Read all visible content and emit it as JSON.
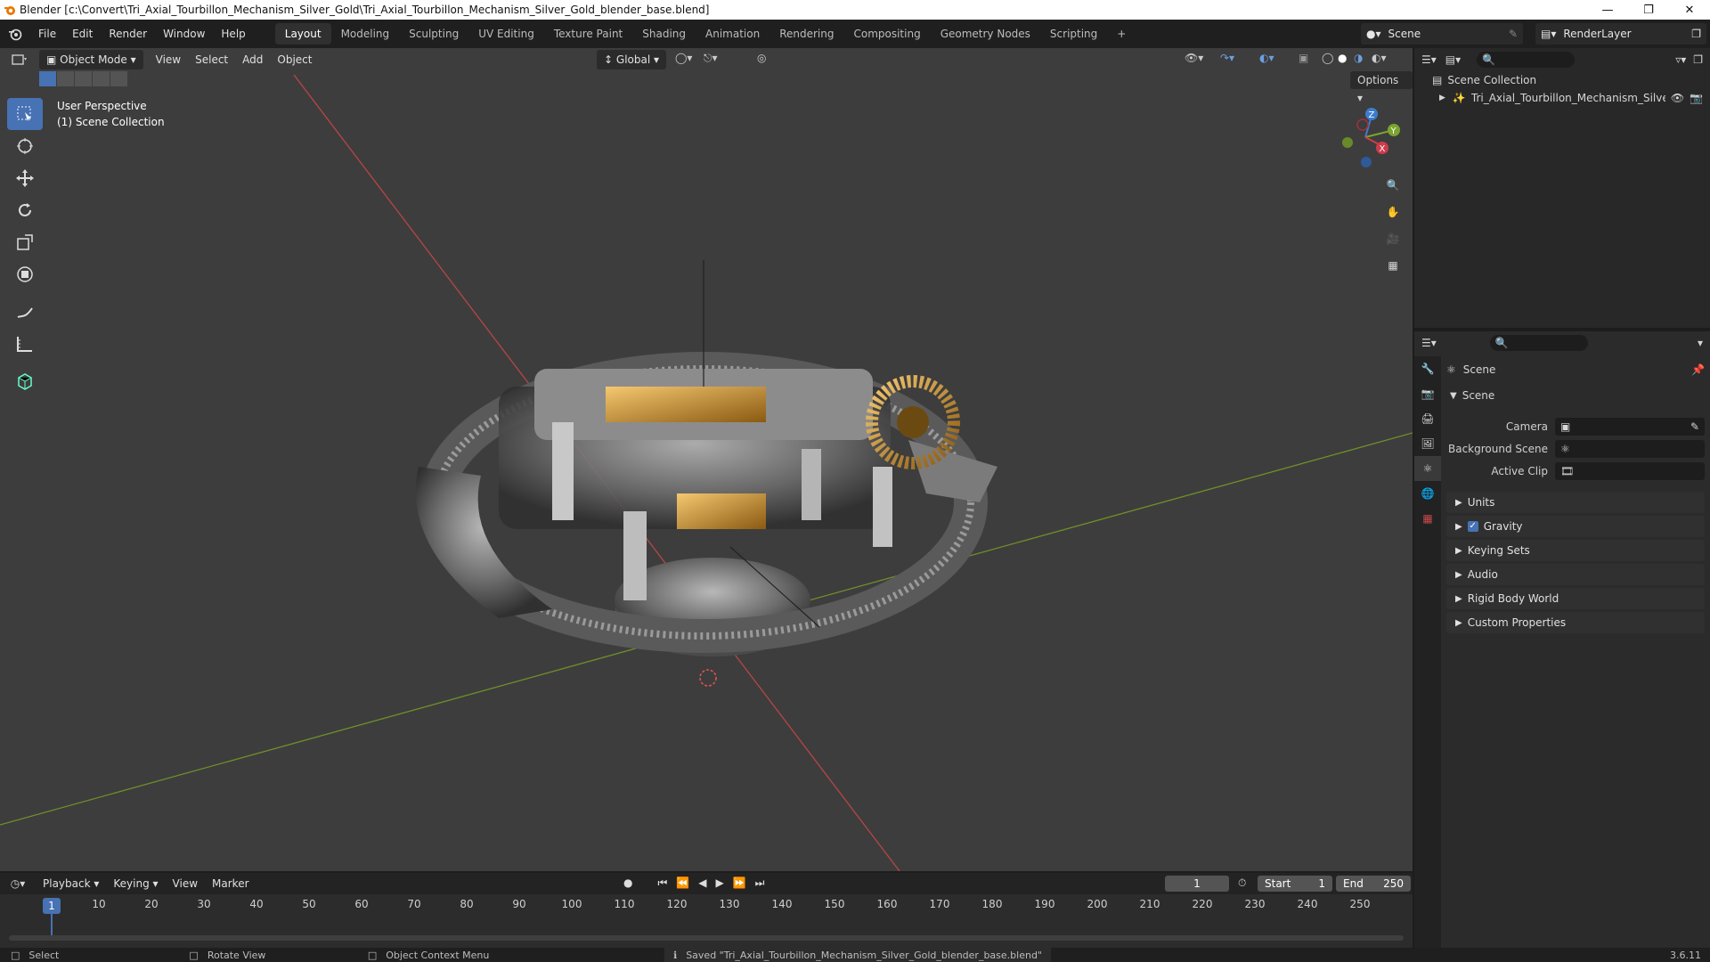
{
  "window": {
    "title": "Blender [c:\\Convert\\Tri_Axial_Tourbillon_Mechanism_Silver_Gold\\Tri_Axial_Tourbillon_Mechanism_Silver_Gold_blender_base.blend]"
  },
  "menu": {
    "items": [
      "File",
      "Edit",
      "Render",
      "Window",
      "Help"
    ]
  },
  "workspaces": {
    "tabs": [
      "Layout",
      "Modeling",
      "Sculpting",
      "UV Editing",
      "Texture Paint",
      "Shading",
      "Animation",
      "Rendering",
      "Compositing",
      "Geometry Nodes",
      "Scripting"
    ],
    "active": "Layout",
    "add_label": "+"
  },
  "scene_selector": {
    "value": "Scene"
  },
  "view_layer": {
    "value": "RenderLayer"
  },
  "viewport": {
    "mode": "Object Mode",
    "menus": [
      "View",
      "Select",
      "Add",
      "Object"
    ],
    "transform_orientation": "Global",
    "options_label": "Options",
    "info_line1": "User Perspective",
    "info_line2": "(1) Scene Collection",
    "axes": {
      "x": "X",
      "y": "Y",
      "z": "Z"
    }
  },
  "outliner": {
    "root": "Scene Collection",
    "object": "Tri_Axial_Tourbillon_Mechanism_Silver_"
  },
  "properties": {
    "header": "Scene",
    "section": "Scene",
    "fields": {
      "camera_label": "Camera",
      "background_label": "Background Scene",
      "clip_label": "Active Clip"
    },
    "panels": [
      "Units",
      "Gravity",
      "Keying Sets",
      "Audio",
      "Rigid Body World",
      "Custom Properties"
    ],
    "gravity_checked": true
  },
  "timeline": {
    "menus": [
      "Playback",
      "Keying",
      "View",
      "Marker"
    ],
    "current_frame": "1",
    "start_label": "Start",
    "start_value": "1",
    "end_label": "End",
    "end_value": "250",
    "ruler": [
      "10",
      "20",
      "30",
      "40",
      "50",
      "60",
      "70",
      "80",
      "90",
      "100",
      "110",
      "120",
      "130",
      "140",
      "150",
      "160",
      "170",
      "180",
      "190",
      "200",
      "210",
      "220",
      "230",
      "240",
      "250"
    ]
  },
  "status": {
    "select": "Select",
    "rotate": "Rotate View",
    "context": "Object Context Menu",
    "message": "Saved \"Tri_Axial_Tourbillon_Mechanism_Silver_Gold_blender_base.blend\"",
    "version": "3.6.11"
  },
  "colors": {
    "accent": "#4772b3",
    "viewport_bg": "#3d3d3d",
    "x_axis": "#c84a4a",
    "y_axis": "#7a9a2e",
    "gold": "#c9962c"
  }
}
